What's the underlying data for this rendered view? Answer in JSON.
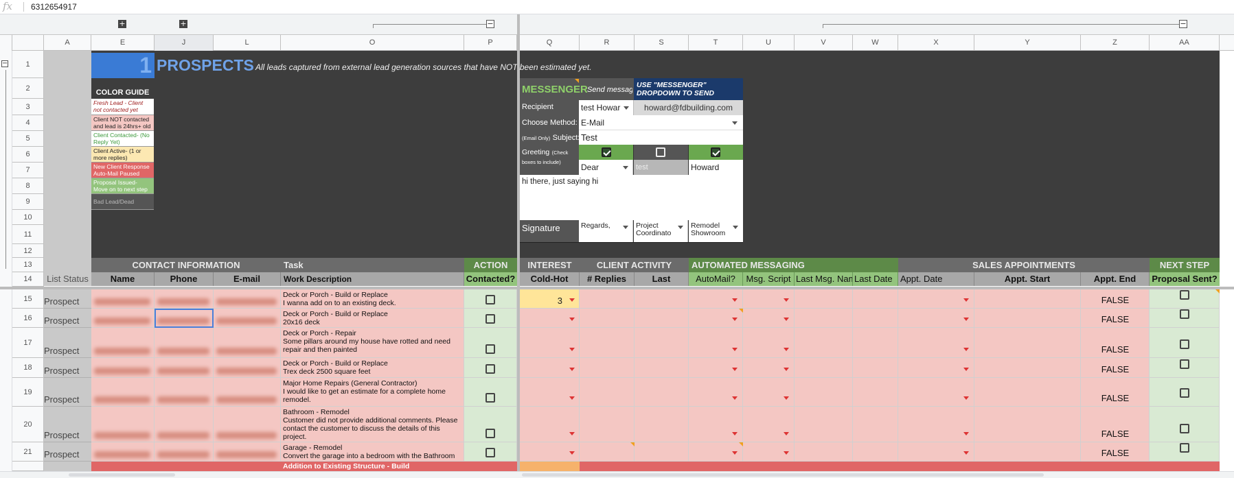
{
  "formula_bar": {
    "fx": "fx",
    "value": "6312654917"
  },
  "columns": [
    "A",
    "E",
    "J",
    "L",
    "O",
    "P",
    "Q",
    "R",
    "S",
    "T",
    "U",
    "V",
    "W",
    "X",
    "Y",
    "Z",
    "AA"
  ],
  "row_numbers": [
    "1",
    "2",
    "3",
    "4",
    "5",
    "6",
    "7",
    "8",
    "9",
    "10",
    "11",
    "12",
    "13",
    "14",
    "15",
    "16",
    "17",
    "18",
    "19",
    "20",
    "21"
  ],
  "banner": {
    "number": "1",
    "title": "PROSPECTS",
    "subtitle": "All leads captured from external lead generation sources that have NOT been estimated yet."
  },
  "color_guide": {
    "title": "COLOR GUIDE",
    "items": [
      {
        "label": "Fresh Lead - Client not contacted yet",
        "bg": "#ffffff",
        "color": "#a02020"
      },
      {
        "label": "Client NOT contacted and lead is 24hrs+ old",
        "bg": "#f4c7c3",
        "color": "#222222"
      },
      {
        "label": "Client Contacted- (No Reply Yet)",
        "bg": "#ffffff",
        "color": "#3c9a3c"
      },
      {
        "label": "Client Active- (1 or more replies)",
        "bg": "#fce8b2",
        "color": "#222222"
      },
      {
        "label": "New Client Response Auto-Mail Paused",
        "bg": "#e06666",
        "color": "#ffffff"
      },
      {
        "label": "Proposal Issued- Move on to next step",
        "bg": "#93c47d",
        "color": "#ffffff"
      },
      {
        "label": "Bad Lead/Dead",
        "bg": "#555555",
        "color": "#bbbbbb"
      }
    ]
  },
  "messenger": {
    "title": "MESSENGER",
    "send_hint": "Send message",
    "use_note": "USE \"MESSENGER\" DROPDOWN TO SEND",
    "recipient_label": "Recipient",
    "recipient_value": "test Howar",
    "recipient_email": "howard@fdbuilding.com",
    "method_label": "Choose Method:",
    "method_value": "E-Mail",
    "subject_label_small": "(Email Only)",
    "subject_label": "Subject:",
    "subject_value": "Test",
    "greeting_label": "Greeting",
    "greeting_hint": "(Check boxes to include)",
    "greeting_words": [
      "Dear",
      "test",
      "Howard"
    ],
    "greeting_checked": [
      true,
      false,
      true
    ],
    "body": "hi there, just saying hi",
    "signature_label": "Signature",
    "signature_values": [
      "Regards,",
      "Project Coordinato",
      "Remodel Showroom"
    ]
  },
  "section_headers": {
    "contact": "CONTACT INFORMATION",
    "task": "Task",
    "action": "ACTION",
    "interest": "INTEREST",
    "client_activity": "CLIENT ACTIVITY",
    "automated": "AUTOMATED MESSAGING",
    "sales": "SALES APPOINTMENTS",
    "next_step": "NEXT STEP"
  },
  "sub_headers": {
    "list_status": "List Status",
    "name": "Name",
    "phone": "Phone",
    "email": "E-mail",
    "work": "Work Description",
    "contacted": "Contacted?",
    "cold_hot": "Cold-Hot",
    "replies": "# Replies",
    "last": "Last",
    "automail": "AutoMail?",
    "script": "Msg. Script",
    "last_msg_name": "Last Msg. Nam",
    "last_date": "Last Date",
    "appt_date": "Appt. Date",
    "appt_start": "Appt. Start",
    "appt_end": "Appt. End",
    "proposal": "Proposal Sent?"
  },
  "rows": [
    {
      "num": "15",
      "status": "Prospect",
      "task_title": "Deck or Porch - Build or Replace",
      "task_desc": "I wanna add on to an existing deck.",
      "cold_hot": "3",
      "appt_end": "FALSE"
    },
    {
      "num": "16",
      "status": "Prospect",
      "task_title": "Deck or Porch - Build or Replace",
      "task_desc": "20x16 deck",
      "cold_hot": "",
      "appt_end": "FALSE"
    },
    {
      "num": "17",
      "status": "Prospect",
      "task_title": "Deck or Porch - Repair",
      "task_desc": "Some pillars around my house have rotted and need repair and then painted",
      "cold_hot": "",
      "appt_end": "FALSE"
    },
    {
      "num": "18",
      "status": "Prospect",
      "task_title": "Deck or Porch - Build or Replace",
      "task_desc": "Trex deck 2500 square feet",
      "cold_hot": "",
      "appt_end": "FALSE"
    },
    {
      "num": "19",
      "status": "Prospect",
      "task_title": "Major Home Repairs (General Contractor)",
      "task_desc": "I would like to get an estimate for  a complete home remodel.",
      "cold_hot": "",
      "appt_end": "FALSE"
    },
    {
      "num": "20",
      "status": "Prospect",
      "task_title": "Bathroom - Remodel",
      "task_desc": "Customer did not provide additional comments.  Please contact the customer to discuss the details of this project.",
      "cold_hot": "",
      "appt_end": "FALSE"
    },
    {
      "num": "21",
      "status": "Prospect",
      "task_title": "Garage - Remodel",
      "task_desc": "Convert the garage into a bedroom with the Bathroom",
      "cold_hot": "",
      "appt_end": "FALSE"
    }
  ],
  "partial_row_task": "Addition to Existing Structure - Build"
}
